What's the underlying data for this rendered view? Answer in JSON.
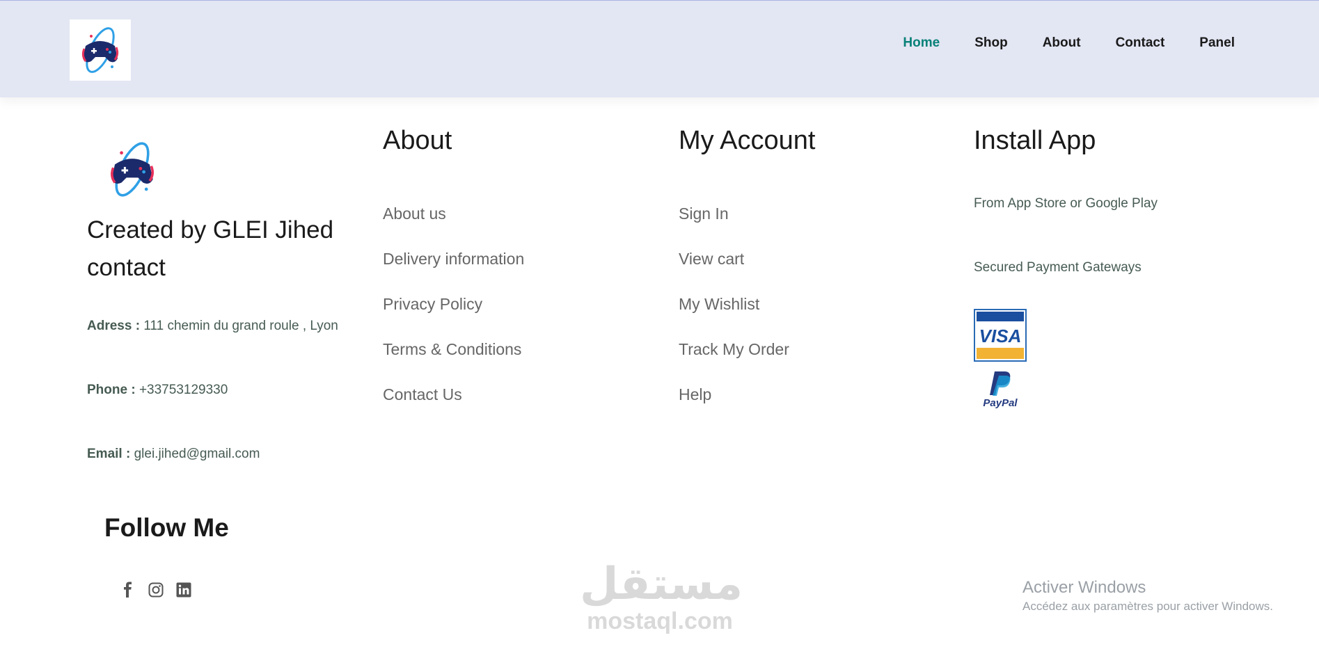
{
  "nav": {
    "items": [
      {
        "label": "Home",
        "active": true
      },
      {
        "label": "Shop",
        "active": false
      },
      {
        "label": "About",
        "active": false
      },
      {
        "label": "Contact",
        "active": false
      },
      {
        "label": "Panel",
        "active": false
      }
    ],
    "logo_icon": "gamepad-orbit-logo"
  },
  "brand": {
    "created_by": "Created by GLEI Jihed contact"
  },
  "contact": {
    "address_label": "Adress :",
    "address_value": "111 chemin du grand roule , Lyon",
    "phone_label": "Phone :",
    "phone_value": "+33753129330",
    "email_label": "Email :",
    "email_value": "glei.jihed@gmail.com"
  },
  "about": {
    "title": "About",
    "links": [
      "About us",
      "Delivery information",
      "Privacy Policy",
      "Terms & Conditions",
      "Contact Us"
    ]
  },
  "account": {
    "title": "My Account",
    "links": [
      "Sign In",
      "View cart",
      "My Wishlist",
      "Track My Order",
      "Help"
    ]
  },
  "install": {
    "title": "Install App",
    "store_text": "From App Store or Google Play",
    "payment_text": "Secured Payment Gateways",
    "visa_text": "VISA",
    "paypal_text": "PayPal"
  },
  "follow": {
    "title": "Follow Me",
    "icons": [
      "facebook-icon",
      "instagram-icon",
      "linkedin-icon"
    ]
  },
  "watermark": {
    "arabic": "مستقل",
    "latin": "mostaql.com"
  },
  "windows": {
    "title": "Activer Windows",
    "subtitle": "Accédez aux paramètres pour activer Windows."
  },
  "colors": {
    "header_bg": "#e3e6f3",
    "accent": "#088178",
    "link": "#666666",
    "text_dark": "#1a1a1a"
  }
}
